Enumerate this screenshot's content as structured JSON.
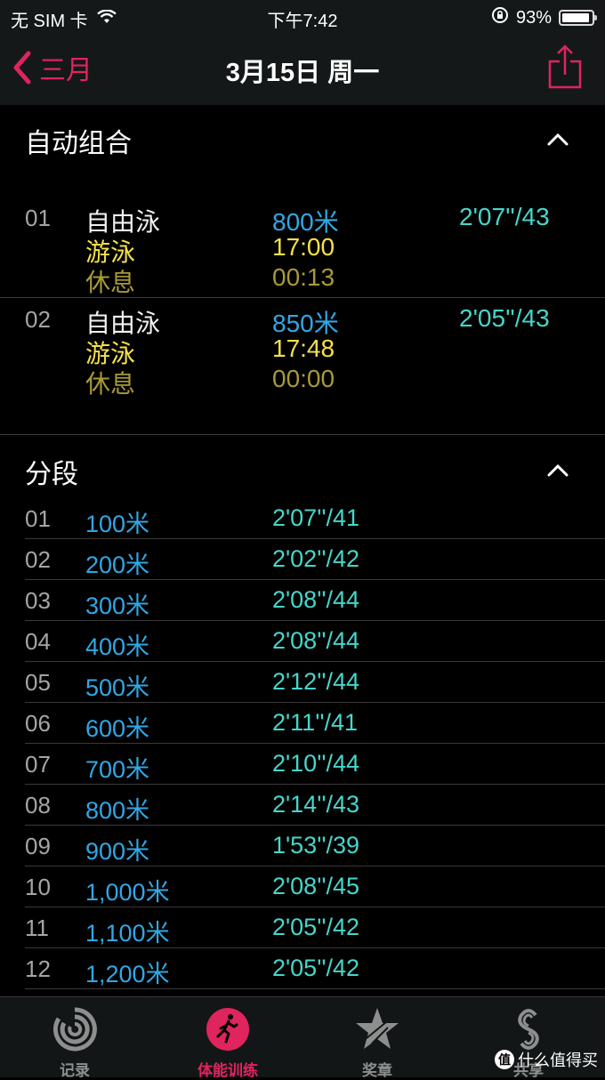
{
  "status_bar": {
    "carrier": "无 SIM 卡",
    "time": "下午7:42",
    "battery_percent": "93%",
    "battery_level": 0.93
  },
  "nav": {
    "back_label": "三月",
    "title": "3月15日 周一"
  },
  "auto_sets": {
    "header": "自动组合",
    "items": [
      {
        "num": "01",
        "stroke": "自由泳",
        "distance": "800米",
        "pace": "2'07''/43",
        "swim_label": "游泳",
        "swim_time": "17:00",
        "rest_label": "休息",
        "rest_time": "00:13"
      },
      {
        "num": "02",
        "stroke": "自由泳",
        "distance": "850米",
        "pace": "2'05''/43",
        "swim_label": "游泳",
        "swim_time": "17:48",
        "rest_label": "休息",
        "rest_time": "00:00"
      }
    ]
  },
  "splits": {
    "header": "分段",
    "rows": [
      {
        "num": "01",
        "distance": "100米",
        "pace": "2'07''/41"
      },
      {
        "num": "02",
        "distance": "200米",
        "pace": "2'02''/42"
      },
      {
        "num": "03",
        "distance": "300米",
        "pace": "2'08''/44"
      },
      {
        "num": "04",
        "distance": "400米",
        "pace": "2'08''/44"
      },
      {
        "num": "05",
        "distance": "500米",
        "pace": "2'12''/44"
      },
      {
        "num": "06",
        "distance": "600米",
        "pace": "2'11''/41"
      },
      {
        "num": "07",
        "distance": "700米",
        "pace": "2'10''/44"
      },
      {
        "num": "08",
        "distance": "800米",
        "pace": "2'14''/43"
      },
      {
        "num": "09",
        "distance": "900米",
        "pace": "1'53''/39"
      },
      {
        "num": "10",
        "distance": "1,000米",
        "pace": "2'08''/45"
      },
      {
        "num": "11",
        "distance": "1,100米",
        "pace": "2'05''/42"
      },
      {
        "num": "12",
        "distance": "1,200米",
        "pace": "2'05''/42"
      }
    ]
  },
  "tab_bar": {
    "tabs": [
      {
        "label": "记录",
        "icon": "history-rings-icon"
      },
      {
        "label": "体能训练",
        "icon": "workout-runner-icon",
        "active": true
      },
      {
        "label": "奖章",
        "icon": "awards-star-icon"
      },
      {
        "label": "共享",
        "icon": "sharing-icon"
      }
    ]
  },
  "watermark": {
    "badge": "值",
    "text": "什么值得买"
  },
  "colors": {
    "accent": "#e0245e",
    "distance": "#31a7e5",
    "pace": "#47d6cb",
    "swim": "#f5e14b",
    "rest": "#a89a38"
  }
}
